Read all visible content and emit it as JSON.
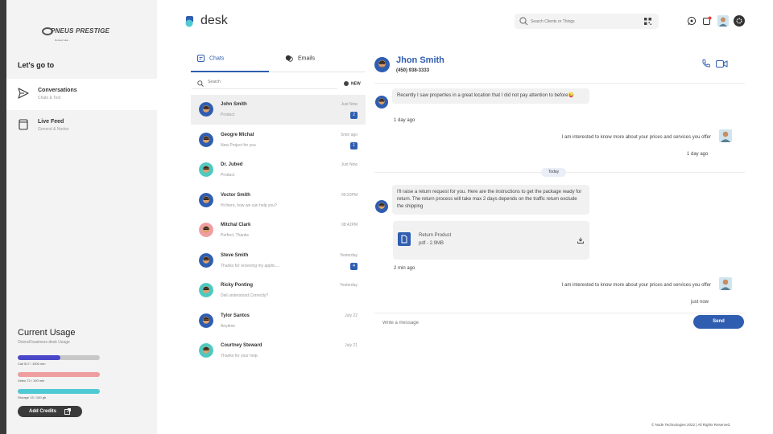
{
  "sidebar": {
    "logo_text": "PNEUS PRESTIGE",
    "logo_sub": "Donnez  LEs...",
    "heading": "Let's go to",
    "nav": [
      {
        "title": "Conversations",
        "subtitle": "Chats & Text",
        "icon": "send-icon",
        "active": true
      },
      {
        "title": "Live Feed",
        "subtitle": "General & Nodes",
        "icon": "feed-icon",
        "active": false
      }
    ],
    "usage": {
      "title": "Current Usage",
      "subtitle": "Overall business desk Usage",
      "bars": [
        {
          "label": "Call 517 / 1000 min",
          "value": 0.517,
          "fill": "#4a47c9"
        },
        {
          "label": "Video 72 / 100 min",
          "value": 1.0,
          "fill": "#ef9ea0"
        },
        {
          "label": "Storage 13 / 100 gb",
          "value": 1.0,
          "fill": "#4fc9d3"
        }
      ],
      "button": "Add Credits"
    }
  },
  "header": {
    "brand": "desk",
    "search_placeholder": "Search Clients or Things",
    "icons": [
      "whatsapp-icon",
      "notification-icon",
      "user-avatar",
      "settings-icon"
    ]
  },
  "chat_list": {
    "tabs": [
      "Chats",
      "Emails"
    ],
    "search_placeholder": "Search",
    "new_label": "NEW",
    "items": [
      {
        "name": "John Smith",
        "preview": "Product",
        "time": "Just Now",
        "badge": "2",
        "avatar_bg": "#2f5db0"
      },
      {
        "name": "Geogre Michal",
        "preview": "New Project for you",
        "time": "5min ago",
        "badge": "1",
        "avatar_bg": "#2f5db0"
      },
      {
        "name": "Dr. Jubed",
        "preview": "Product",
        "time": "Just Now",
        "badge": "",
        "avatar_bg": "#4fc9c0"
      },
      {
        "name": "Voctor Smith",
        "preview": "Hi there, how we can help you?",
        "time": "09:20PM",
        "badge": "",
        "avatar_bg": "#2f5db0"
      },
      {
        "name": "Mitchal Clark",
        "preview": "Perfect, Thanks",
        "time": "08:42PM",
        "badge": "",
        "avatar_bg": "#ef9ea0"
      },
      {
        "name": "Steve Smith",
        "preview": "Thanks for recieving my applic....",
        "time": "Yesterday",
        "badge": "4",
        "avatar_bg": "#2f5db0"
      },
      {
        "name": "Ricky Ponting",
        "preview": "Deli understood Correctly?",
        "time": "Yesterday",
        "badge": "",
        "avatar_bg": "#4fc9c0"
      },
      {
        "name": "Tylor Santos",
        "preview": "Anytime",
        "time": "July 22",
        "badge": "",
        "avatar_bg": "#2f5db0"
      },
      {
        "name": "Courtney Steward",
        "preview": "Thanks for your help.",
        "time": "July 21",
        "badge": "",
        "avatar_bg": "#4fc9c0"
      }
    ]
  },
  "conversation": {
    "name": "Jhon Smith",
    "phone": "(450) 938-3333",
    "messages": [
      {
        "text": "Recently I saw properties in a great location that I did not pay attention to before😜",
        "time": "1 day ago"
      },
      {
        "text": "I am interested to know more about your prices and services you offer",
        "time": "1 day ago"
      },
      {
        "text": "I'll raise a return request for you. Here are the instructions to get the package ready for return. The return process will take max 2 days depends on the traffic return exclude the shipping",
        "time": "2 min ago"
      },
      {
        "text": "I am interested to know more about your prices and services you offer",
        "time": "just now"
      }
    ],
    "divider": "Today",
    "attachment": {
      "name": "Return Product",
      "meta": "pdf - 2.9MB"
    },
    "compose_placeholder": "Write a message",
    "send_label": "Send"
  },
  "footer": "© Node Technologies 2022 | All Rights Reserved.",
  "colors": {
    "accent": "#2f5db0",
    "sidebar_bg": "#f3f3f3"
  }
}
